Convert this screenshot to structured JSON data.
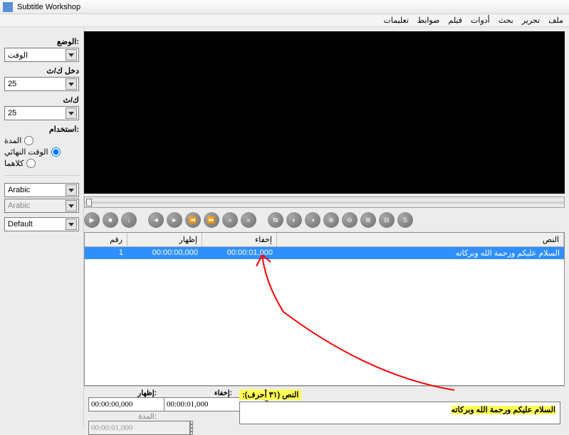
{
  "window": {
    "title": "Subtitle Workshop"
  },
  "menu": [
    "ملف",
    "تحرير",
    "بحث",
    "أدوات",
    "فيلم",
    "ضوابط",
    "تعليمات"
  ],
  "sidebar": {
    "mode_label": "الوضع:",
    "mode_value": "الوقت",
    "inputfr_label": "دخل ك/ث",
    "inputfr_value": "25",
    "fr_label": "ك/ث",
    "fr_value": "25",
    "use_label": "استخدام:",
    "radios": [
      "المدة",
      "الوقت النهائي",
      "كلاهما"
    ],
    "charset1": "Arabic",
    "charset2": "Arabic",
    "format": "Default"
  },
  "grid": {
    "headers": [
      "رقم",
      "إظهار",
      "إخفاء",
      "النص"
    ],
    "row": {
      "num": "1",
      "show": "00:00:00,000",
      "hide": "00:00:01,000",
      "text": "السلام عليكم ورحمة الله وبركاته"
    }
  },
  "bottom": {
    "show_label": "إظهار:",
    "show_value": "00:00:00,000",
    "hide_label": "إخفاء:",
    "hide_value": "00:00:01,000",
    "dur_label": "المدة:",
    "dur_value": "00:00:01,000",
    "text_label": ":(النص (٣١ أحرف",
    "text_value": "السلام عليكم ورحمة الله وبركاته"
  }
}
